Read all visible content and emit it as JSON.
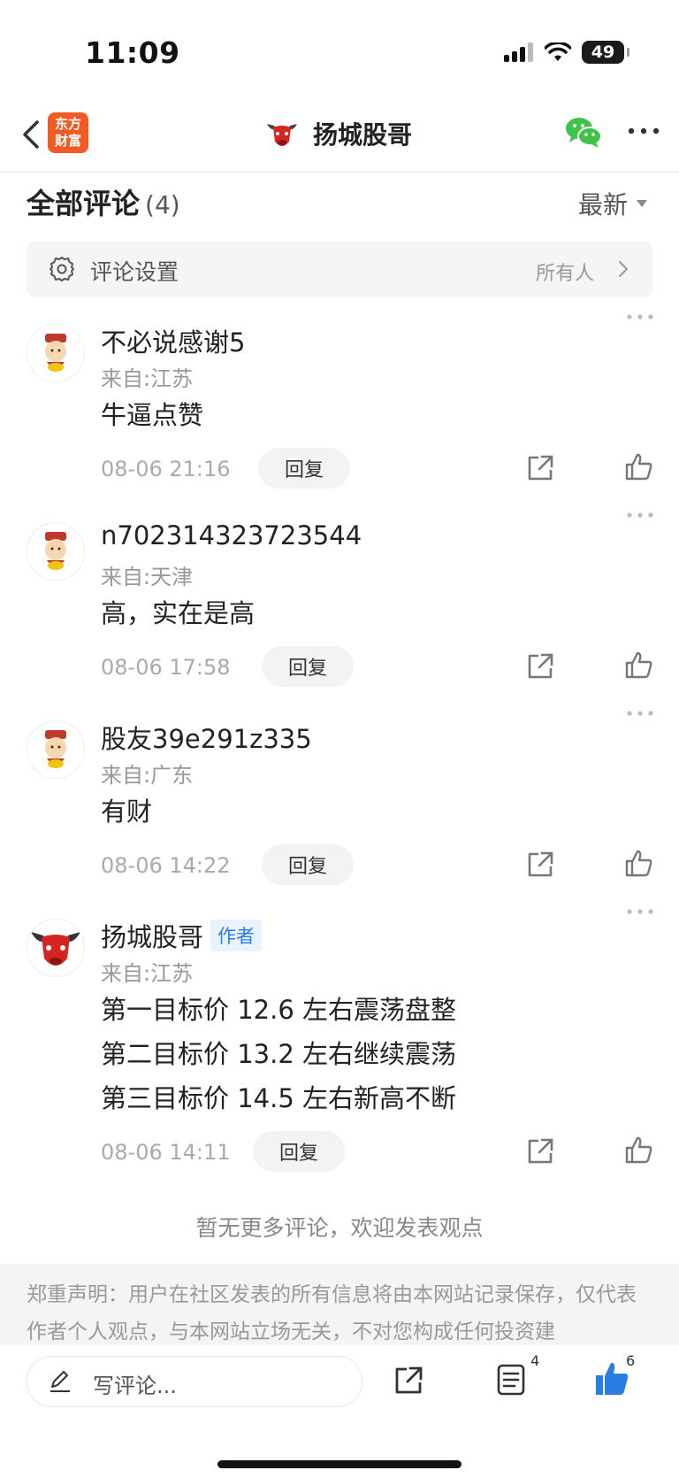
{
  "status_bar": {
    "time": "11:09",
    "battery": "49"
  },
  "nav": {
    "app_logo_line1": "东方",
    "app_logo_line2": "财富",
    "title": "扬城股哥"
  },
  "header": {
    "title": "全部评论",
    "count": "(4)",
    "sort_label": "最新"
  },
  "settings": {
    "label": "评论设置",
    "value": "所有人"
  },
  "comments": [
    {
      "username": "不必说感谢5",
      "location": "来自:江苏",
      "lines": [
        "牛逼点赞"
      ],
      "time": "08-06 21:16",
      "reply": "回复"
    },
    {
      "username": "n702314323723544",
      "location": "来自:天津",
      "lines": [
        "高，实在是高"
      ],
      "time": "08-06 17:58",
      "reply": "回复"
    },
    {
      "username": "股友39e291z335",
      "location": "来自:广东",
      "lines": [
        "有财"
      ],
      "time": "08-06 14:22",
      "reply": "回复"
    },
    {
      "username": "扬城股哥",
      "badge": "作者",
      "location": "来自:江苏",
      "lines": [
        "第一目标价 12.6 左右震荡盘整",
        "第二目标价 13.2 左右继续震荡",
        "第三目标价 14.5 左右新高不断"
      ],
      "time": "08-06 14:11",
      "reply": "回复"
    }
  ],
  "no_more": "暂无更多评论，欢迎发表观点",
  "disclaimer": "郑重声明：用户在社区发表的所有信息将由本网站记录保存，仅代表作者个人观点，与本网站立场无关，不对您构成任何投资建",
  "bottom_bar": {
    "comment_placeholder": "写评论...",
    "list_count": "4",
    "like_count": "6"
  },
  "colors": {
    "accent_blue": "#2a7de1",
    "logo_orange": "#f15a22",
    "wechat_green": "#3fc34a"
  }
}
